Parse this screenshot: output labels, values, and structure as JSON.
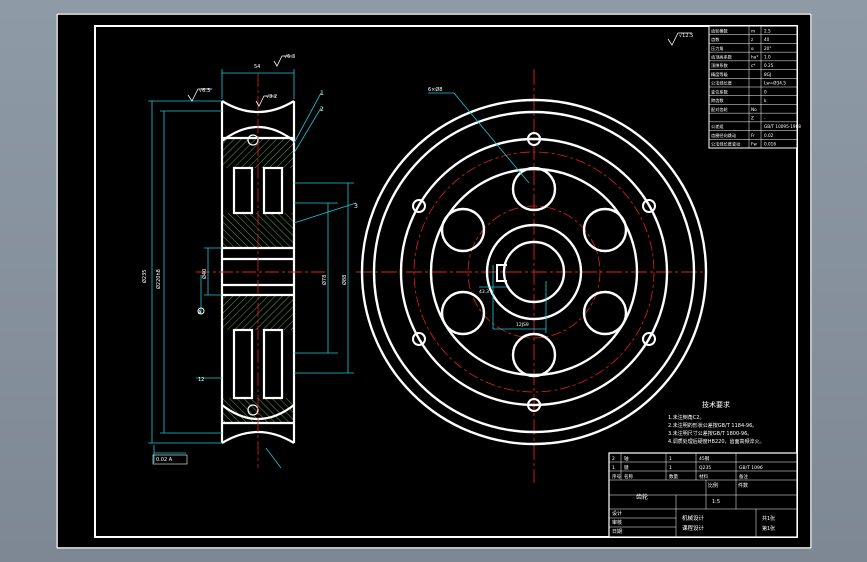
{
  "drawing": {
    "surface_finish_marks": [
      "√12.5",
      "√6.3",
      "√6.3",
      "√3.2"
    ],
    "section_view": {
      "part_callouts": [
        "1",
        "2",
        "3"
      ],
      "dimension_labels": [
        "54",
        "Ø235",
        "Ø220h8",
        "Ø78",
        "Ø88",
        "Ø40",
        "12"
      ],
      "datum_label": "A",
      "tolerance_frame": "0.02 A"
    },
    "front_view": {
      "hole_callout": "6×Ø8",
      "keyway_labels": [
        "43.3",
        "12JS9"
      ]
    }
  },
  "params_table": {
    "rows": [
      {
        "name": "齿轮模数",
        "sym": "m",
        "val": "2.5"
      },
      {
        "name": "齿数",
        "sym": "z",
        "val": "40"
      },
      {
        "name": "压力角",
        "sym": "α",
        "val": "20°"
      },
      {
        "name": "齿顶高系数",
        "sym": "ha*",
        "val": "1.0"
      },
      {
        "name": "顶隙系数",
        "sym": "c*",
        "val": "0.25"
      },
      {
        "name": "精度等级",
        "sym": "",
        "val": "8GJ"
      },
      {
        "name": "公法线长度",
        "sym": "",
        "val": "Lw=Ø34.5"
      },
      {
        "name": "变位系数",
        "sym": "",
        "val": "0"
      },
      {
        "name": "跨齿数",
        "sym": "",
        "val": "k"
      },
      {
        "name": "配对齿轮",
        "sym": "No",
        "val": ""
      },
      {
        "name": "",
        "sym": "Z",
        "val": "-"
      },
      {
        "name": "公差组",
        "sym": "",
        "val": "GB/T 10095-1988"
      },
      {
        "name": "齿圈径向跳动",
        "sym": "Fr",
        "val": "0.02"
      },
      {
        "name": "公法线长度变动",
        "sym": "Fw",
        "val": "0.016"
      }
    ]
  },
  "tech_requirements": {
    "title": "技术要求",
    "items": [
      "1.未注倒角C2。",
      "2.未注明的形状公差按GB/T 1184-96。",
      "3.未注明尺寸公差按GB/T 1800-96。",
      "4.调质处理后硬度HB220，齿面高频淬火。"
    ]
  },
  "title_block": {
    "rows": [
      [
        "2",
        "轴",
        "1",
        "45钢",
        ""
      ],
      [
        "1",
        "键",
        "1",
        "Q235",
        "GB/T 1096"
      ],
      [
        "序号",
        "名称",
        "数量",
        "材料",
        "备注"
      ]
    ],
    "drawing_name": "齿轮",
    "scale_label": "比例",
    "scale_value": "1:5",
    "count_label": "件数",
    "school": "机械设计",
    "course": "课程设计",
    "sheet_label": "共1张",
    "sheet_num": "第1张",
    "designer": "设计",
    "checker": "审核",
    "date_label": "日期"
  }
}
